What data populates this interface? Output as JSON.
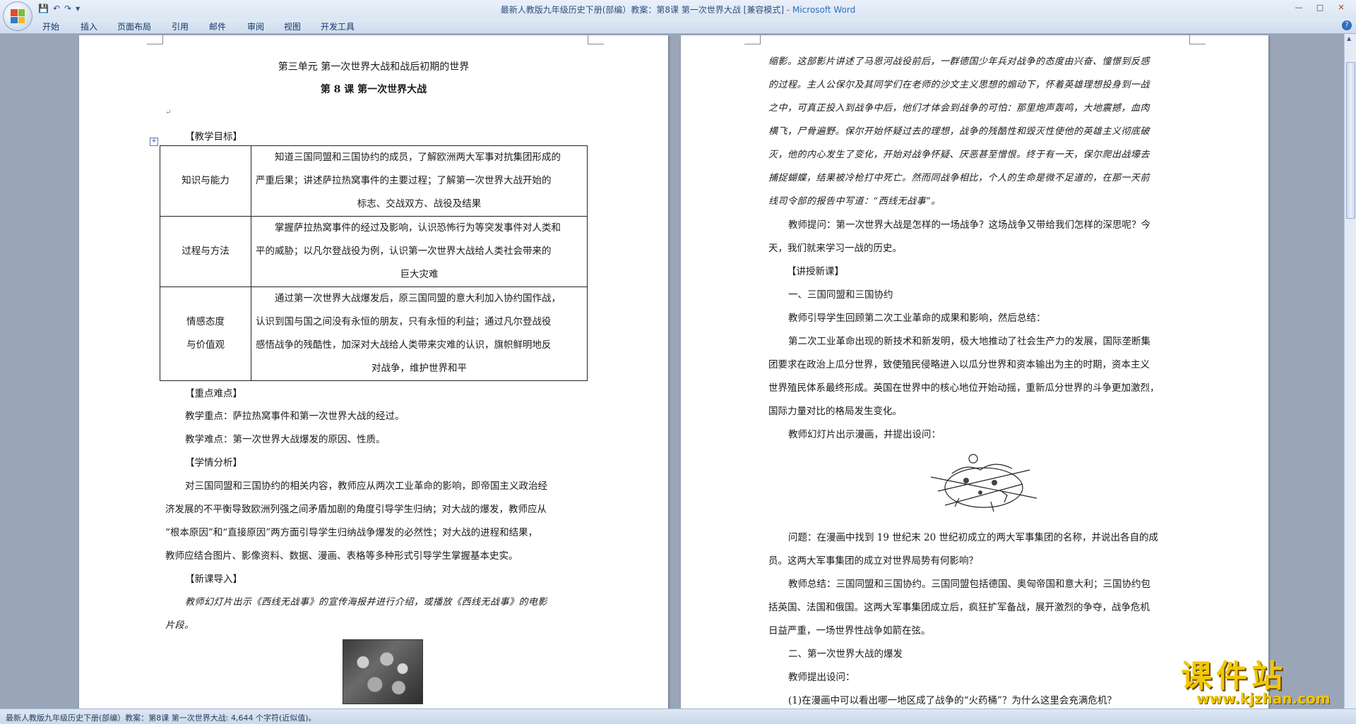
{
  "window": {
    "title": "最新人教版九年级历史下册(部编）教案：第8课   第一次世界大战 [兼容模式]",
    "app_name": " - Microsoft Word",
    "controls": [
      "—",
      "□",
      "✕"
    ]
  },
  "qat": {
    "save": "💾",
    "undo": "↶",
    "redo": "↷",
    "more": "▾"
  },
  "ribbon": {
    "tabs": [
      "开始",
      "插入",
      "页面布局",
      "引用",
      "邮件",
      "审阅",
      "视图",
      "开发工具"
    ]
  },
  "page1": {
    "unit_title": "第三单元    第一次世界大战和战后初期的世界",
    "lesson_title": "第 8 课    第一次世界大战",
    "objectives_heading": "【教学目标】",
    "objectives": [
      {
        "label_lines": [
          "知识与能力"
        ],
        "text_lines": [
          "知道三国同盟和三国协约的成员，了解欧洲两大军事对抗集团形成的",
          "严重后果；讲述萨拉热窝事件的主要过程；了解第一次世界大战开始的",
          "标志、交战双方、战役及结果"
        ]
      },
      {
        "label_lines": [
          "过程与方法"
        ],
        "text_lines": [
          "掌握萨拉热窝事件的经过及影响，认识恐怖行为等突发事件对人类和",
          "平的威胁；以凡尔登战役为例，认识第一次世界大战给人类社会带来的",
          "巨大灾难"
        ]
      },
      {
        "label_lines": [
          "情感态度",
          "与价值观"
        ],
        "text_lines": [
          "通过第一次世界大战爆发后，原三国同盟的意大利加入协约国作战，",
          "认识到国与国之间没有永恒的朋友，只有永恒的利益；通过凡尔登战役",
          "感悟战争的残酷性，加深对大战给人类带来灾难的认识，旗帜鲜明地反",
          "对战争，维护世界和平"
        ]
      }
    ],
    "key_heading": "【重点难点】",
    "key_point": "教学重点：萨拉热窝事件和第一次世界大战的经过。",
    "difficult_point": "教学难点：第一次世界大战爆发的原因、性质。",
    "analysis_heading": "【学情分析】",
    "analysis_lines": [
      "对三国同盟和三国协约的相关内容，教师应从两次工业革命的影响，即帝国主义政治经",
      "济发展的不平衡导致欧洲列强之间矛盾加剧的角度引导学生归纳；对大战的爆发，教师应从",
      "“根本原因”和“直接原因”两方面引导学生归纳战争爆发的必然性；对大战的进程和结果，",
      "教师应结合图片、影像资料、数据、漫画、表格等多种形式引导学生掌握基本史实。"
    ],
    "intro_heading": "【新课导入】",
    "intro_lines": [
      "教师幻灯片出示《西线无战事》的宣传海报并进行介绍，或播放《西线无战事》的电影",
      "片段。"
    ]
  },
  "page2": {
    "lines_top": [
      "缩影。这部影片讲述了马恩河战役前后，一群德国少年兵对战争的态度由兴奋、憧憬到反感",
      "的过程。主人公保尔及其同学们在老师的沙文主义思想的煽动下，怀着英雄理想投身到一战",
      "之中，可真正投入到战争中后，他们才体会到战争的可怕：那里炮声轰鸣，大地震撼，血肉",
      "横飞，尸骨遍野。保尔开始怀疑过去的理想，战争的残酷性和毁灭性使他的英雄主义彻底破",
      "灭，他的内心发生了变化，开始对战争怀疑、厌恶甚至憎恨。终于有一天，保尔爬出战壕去",
      "捕捉蝴蝶，结果被冷枪打中死亡。然而同战争相比，个人的生命是微不足道的，在那一天前",
      "线司令部的报告中写道：“西线无战事”。"
    ],
    "teacher_question": [
      "教师提问：第一次世界大战是怎样的一场战争？这场战争又带给我们怎样的深思呢？今",
      "天，我们就来学习一战的历史。"
    ],
    "new_lesson_heading": "【讲授新课】",
    "section1": "一、三国同盟和三国协约",
    "guide": "教师引导学生回顾第二次工业革命的成果和影响，然后总结：",
    "summary_lines": [
      "第二次工业革命出现的新技术和新发明，极大地推动了社会生产力的发展，国际垄断集",
      "团要求在政治上瓜分世界，致使殖民侵略进入以瓜分世界和资本输出为主的时期，资本主义",
      "世界殖民体系最终形成。英国在世界中的核心地位开始动摇，重新瓜分世界的斗争更加激烈，",
      "国际力量对比的格局发生变化。"
    ],
    "cartoon_prompt": "教师幻灯片出示漫画，并提出设问：",
    "question_lines": [
      "问题：在漫画中找到 19 世纪末 20 世纪初成立的两大军事集团的名称，并说出各自的成",
      "员。这两大军事集团的成立对世界局势有何影响？"
    ],
    "teacher_summary_lines": [
      "教师总结：三国同盟和三国协约。三国同盟包括德国、奥匈帝国和意大利；三国协约包",
      "括英国、法国和俄国。这两大军事集团成立后，疯狂扩军备战，展开激烈的争夺，战争危机",
      "日益严重，一场世界性战争如箭在弦。"
    ],
    "section2": "二、第一次世界大战的爆发",
    "teacher_ask": "教师提出设问：",
    "q1": "(1)在漫画中可以看出哪一地区成了战争的“火药桶”？为什么这里会充满危机？"
  },
  "status": {
    "text": "最新人教版九年级历史下册(部编）教案：第8课    第一次世界大战: 4,644 个字符(近似值)。"
  },
  "watermark": {
    "big": "课件站",
    "url": "www.kjzhan.com"
  },
  "colors": {
    "frame": "#9aa6b7",
    "ribbon": "#dfe9f5",
    "accent": "#2f6db7",
    "watermark": "#f2c700"
  }
}
